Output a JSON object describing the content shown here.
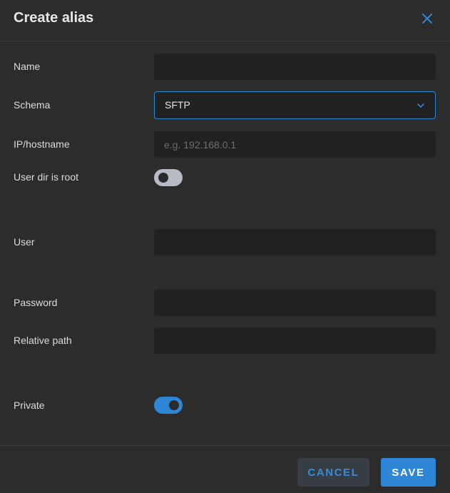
{
  "dialog": {
    "title": "Create alias",
    "close_icon": "close-icon"
  },
  "form": {
    "name": {
      "label": "Name",
      "value": ""
    },
    "schema": {
      "label": "Schema",
      "value": "SFTP"
    },
    "ip_hostname": {
      "label": "IP/hostname",
      "value": "",
      "placeholder": "e.g. 192.168.0.1"
    },
    "user_dir_is_root": {
      "label": "User dir is root",
      "checked": false
    },
    "user": {
      "label": "User",
      "value": ""
    },
    "password": {
      "label": "Password",
      "value": ""
    },
    "relative_path": {
      "label": "Relative path",
      "value": ""
    },
    "private": {
      "label": "Private",
      "checked": true
    }
  },
  "footer": {
    "cancel_label": "CANCEL",
    "save_label": "SAVE"
  },
  "colors": {
    "background": "#2c2c2c",
    "field": "#212121",
    "accent": "#2f86d6"
  }
}
